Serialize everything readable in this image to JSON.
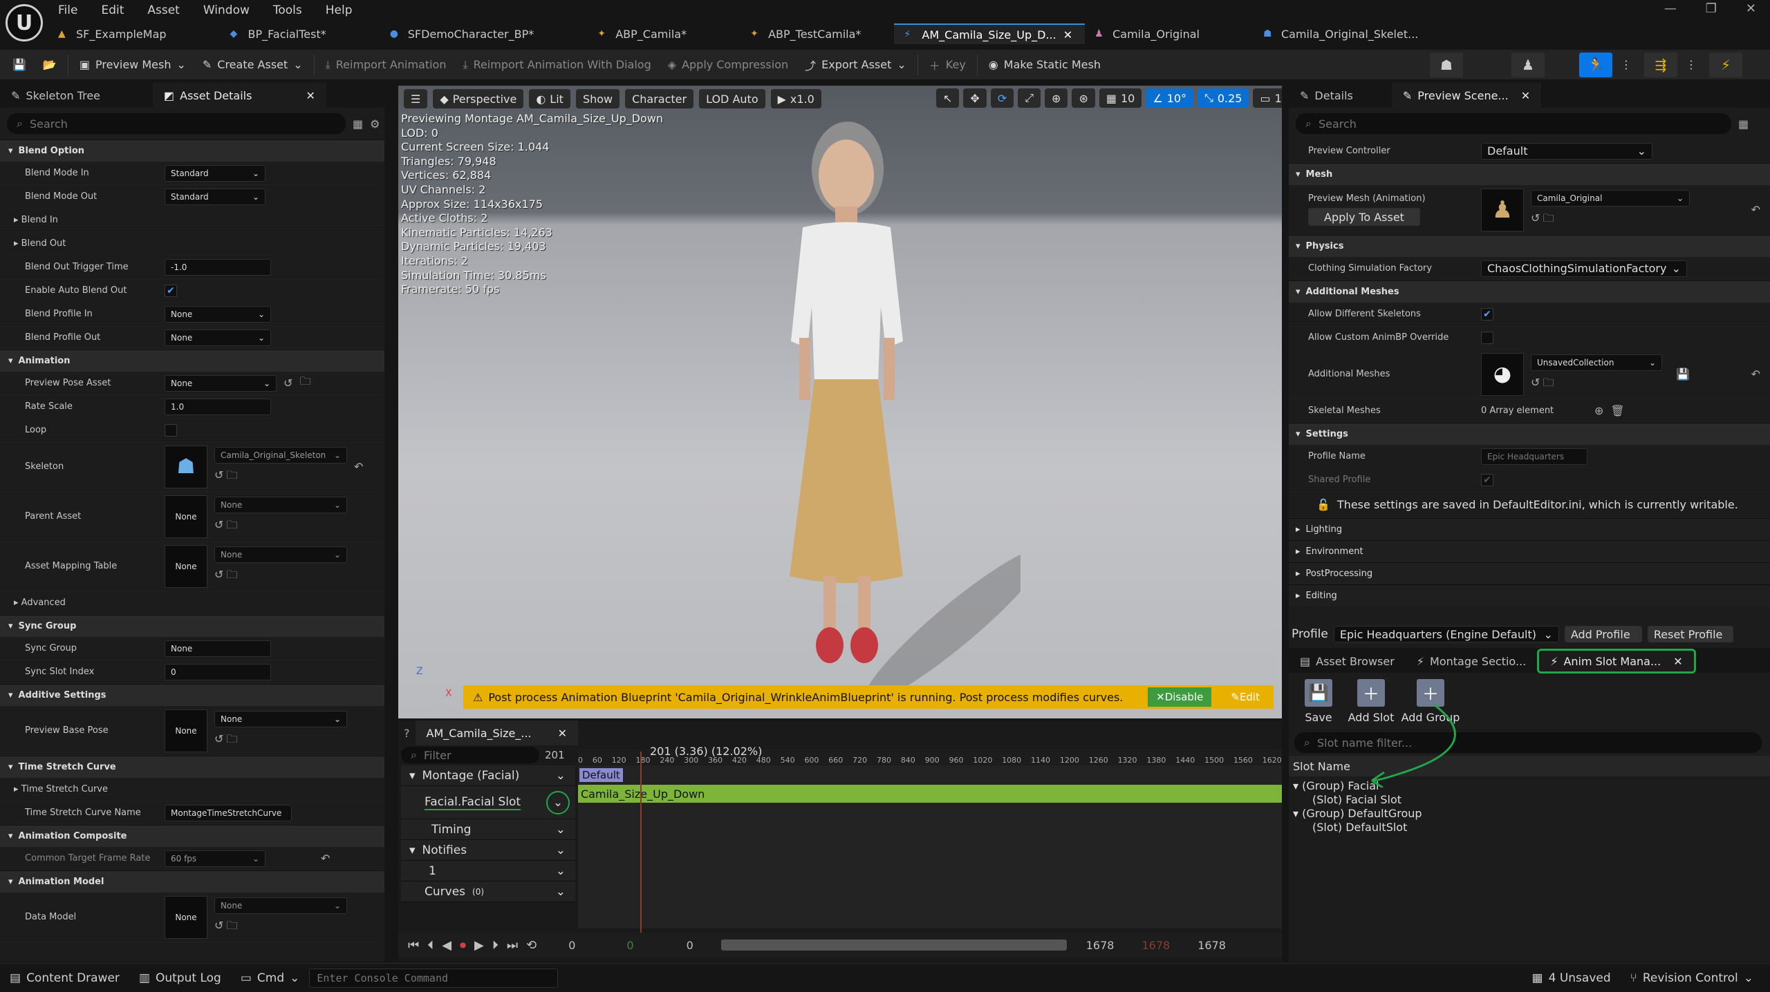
{
  "menu": [
    "File",
    "Edit",
    "Asset",
    "Window",
    "Tools",
    "Help"
  ],
  "window_controls": [
    "—",
    "❐",
    "✕"
  ],
  "tabs": [
    {
      "label": "SF_ExampleMap",
      "active": false
    },
    {
      "label": "BP_FacialTest*",
      "active": false
    },
    {
      "label": "SFDemoCharacter_BP*",
      "active": false
    },
    {
      "label": "ABP_Camila*",
      "active": false
    },
    {
      "label": "ABP_TestCamila*",
      "active": false
    },
    {
      "label": "AM_Camila_Size_Up_D...",
      "active": true
    },
    {
      "label": "Camila_Original",
      "active": false
    },
    {
      "label": "Camila_Original_Skelet...",
      "active": false
    }
  ],
  "toolbar": {
    "preview_mesh": "Preview Mesh",
    "create_asset": "Create Asset",
    "reimport": "Reimport Animation",
    "reimport_dialog": "Reimport Animation With Dialog",
    "apply_compression": "Apply Compression",
    "export_asset": "Export Asset",
    "key": "Key",
    "make_static_mesh": "Make Static Mesh"
  },
  "left_panel": {
    "tab_skeleton": "Skeleton Tree",
    "tab_details": "Asset Details",
    "search_placeholder": "Search",
    "blend_option": "Blend Option",
    "blend_mode_in": {
      "label": "Blend Mode In",
      "value": "Standard"
    },
    "blend_mode_out": {
      "label": "Blend Mode Out",
      "value": "Standard"
    },
    "blend_in": "Blend In",
    "blend_out": "Blend Out",
    "blend_out_trigger": {
      "label": "Blend Out Trigger Time",
      "value": "-1.0"
    },
    "auto_blend": {
      "label": "Enable Auto Blend Out"
    },
    "blend_profile_in": {
      "label": "Blend Profile In",
      "value": "None"
    },
    "blend_profile_out": {
      "label": "Blend Profile Out",
      "value": "None"
    },
    "animation": "Animation",
    "preview_pose": {
      "label": "Preview Pose Asset",
      "value": "None"
    },
    "rate_scale": {
      "label": "Rate Scale",
      "value": "1.0"
    },
    "loop": {
      "label": "Loop"
    },
    "skeleton": {
      "label": "Skeleton",
      "value": "Camila_Original_Skeleton"
    },
    "parent_asset": {
      "label": "Parent Asset",
      "value": "None",
      "thumb": "None"
    },
    "mapping_table": {
      "label": "Asset Mapping Table",
      "value": "None",
      "thumb": "None"
    },
    "advanced": "Advanced",
    "sync_group_section": "Sync Group",
    "sync_group": {
      "label": "Sync Group",
      "value": "None"
    },
    "sync_slot": {
      "label": "Sync Slot Index",
      "value": "0"
    },
    "additive": "Additive Settings",
    "preview_base_pose": {
      "label": "Preview Base Pose",
      "value": "None",
      "thumb": "None"
    },
    "time_stretch_section": "Time Stretch Curve",
    "time_stretch": "Time Stretch Curve",
    "time_stretch_name": {
      "label": "Time Stretch Curve Name",
      "value": "MontageTimeStretchCurve"
    },
    "anim_composite": "Animation Composite",
    "frame_rate": {
      "label": "Common Target Frame Rate",
      "value": "60 fps"
    },
    "anim_model": "Animation Model",
    "data_model": {
      "label": "Data Model",
      "value": "None",
      "thumb": "None"
    }
  },
  "viewport": {
    "perspective": "Perspective",
    "lit": "Lit",
    "show": "Show",
    "character": "Character",
    "lod": "LOD Auto",
    "speed": "x1.0",
    "grid_num": "10",
    "angle": "10°",
    "scale": "0.25",
    "cam": "1",
    "stats": [
      "Previewing Montage AM_Camila_Size_Up_Down",
      "LOD: 0",
      "Current Screen Size: 1.044",
      "Triangles: 79,948",
      "Vertices: 62,884",
      "UV Channels: 2",
      "Approx Size: 114x36x175",
      "Active Cloths: 2",
      "Kinematic Particles: 14,263",
      "Dynamic Particles: 19,403",
      "Iterations: 2",
      "Simulation Time: 30.85ms",
      "Framerate: 50 fps"
    ],
    "banner": "Post process Animation Blueprint 'Camila_Original_WrinkleAnimBlueprint' is running. Post process modifies curves.",
    "disable": "Disable",
    "edit": "Edit",
    "axis_x": "X",
    "axis_z": "Z"
  },
  "timeline": {
    "tab": "AM_Camila_Size_...",
    "filter_placeholder": "Filter",
    "frame_field": "201",
    "playhead_label": "201 (3.36) (12.02%)",
    "ruler": [
      "0",
      "60",
      "120",
      "180",
      "240",
      "300",
      "360",
      "420",
      "480",
      "540",
      "600",
      "660",
      "720",
      "780",
      "840",
      "900",
      "960",
      "1020",
      "1080",
      "1140",
      "1200",
      "1260",
      "1320",
      "1380",
      "1440",
      "1500",
      "1560",
      "1620"
    ],
    "montage": "Montage (Facial)",
    "slot": "Facial.Facial Slot",
    "timing": "Timing",
    "notifies": "Notifies",
    "notify_1": "1",
    "curves": "Curves",
    "curves_count": "(0)",
    "default_section": "Default",
    "clip": "Camila_Size_Up_Down",
    "bottom_values": [
      "0",
      "0",
      "0",
      "1678",
      "1678",
      "1678"
    ]
  },
  "right_panel": {
    "tab_details": "Details",
    "tab_preview": "Preview Scene...",
    "search_placeholder": "Search",
    "preview_controller": {
      "label": "Preview Controller",
      "value": "Default"
    },
    "mesh": "Mesh",
    "preview_mesh": {
      "label": "Preview Mesh (Animation)",
      "value": "Camila_Original"
    },
    "apply": "Apply To Asset",
    "physics": "Physics",
    "cloth_factory": {
      "label": "Clothing Simulation Factory",
      "value": "ChaosClothingSimulationFactory"
    },
    "additional_meshes_section": "Additional Meshes",
    "allow_skeletons": {
      "label": "Allow Different Skeletons"
    },
    "allow_animbp": {
      "label": "Allow Custom AnimBP Override"
    },
    "additional_meshes": {
      "label": "Additional Meshes",
      "value": "UnsavedCollection"
    },
    "skeletal_meshes": {
      "label": "Skeletal Meshes",
      "value": "0 Array element"
    },
    "settings": "Settings",
    "profile_name": {
      "label": "Profile Name",
      "value": "Epic Headquarters"
    },
    "shared_profile": {
      "label": "Shared Profile"
    },
    "settings_note": "These settings are saved in DefaultEditor.ini, which is currently writable.",
    "lighting": "Lighting",
    "environment": "Environment",
    "post": "PostProcessing",
    "editing": "Editing",
    "profile_label": "Profile",
    "profile_value": "Epic Headquarters (Engine Default)",
    "add_profile": "Add Profile",
    "reset_profile": "Reset Profile"
  },
  "anim_panel": {
    "tab_browser": "Asset Browser",
    "tab_montage": "Montage Sectio...",
    "tab_slot": "Anim Slot Mana...",
    "save": "Save",
    "add_slot": "Add Slot",
    "add_group": "Add Group",
    "filter_placeholder": "Slot name filter...",
    "header": "Slot Name",
    "tree": [
      {
        "label": "(Group) Facial",
        "indent": 0
      },
      {
        "label": "(Slot) Facial Slot",
        "indent": 1
      },
      {
        "label": "(Group) DefaultGroup",
        "indent": 0
      },
      {
        "label": "(Slot) DefaultSlot",
        "indent": 1
      }
    ]
  },
  "status": {
    "content_drawer": "Content Drawer",
    "output_log": "Output Log",
    "cmd": "Cmd",
    "console_placeholder": "Enter Console Command",
    "unsaved": "4 Unsaved",
    "revision": "Revision Control"
  },
  "accent": "#0a77e8",
  "annotation_color": "#1fa84a"
}
